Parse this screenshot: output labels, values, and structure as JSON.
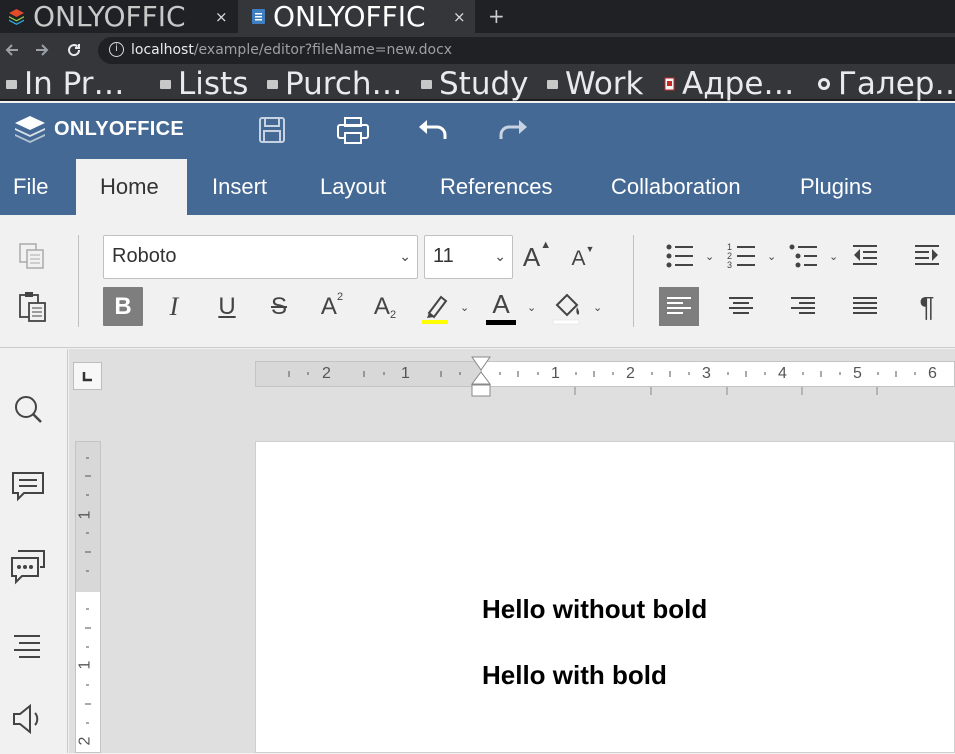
{
  "browser": {
    "tabs": [
      {
        "title": "ONLYOFFIC",
        "close": "×"
      },
      {
        "title": "ONLYOFFIC",
        "close": "×"
      }
    ],
    "new_tab": "+",
    "url_host": "localhost",
    "url_path": "/example/editor?fileName=new.docx",
    "bookmarks": [
      {
        "label": "In Pr…"
      },
      {
        "label": "Lists"
      },
      {
        "label": "Purch…"
      },
      {
        "label": "Study"
      },
      {
        "label": "Work"
      },
      {
        "label": "Адре…"
      },
      {
        "label": "Галер…"
      }
    ]
  },
  "app": {
    "brand": "ONLYOFFICE",
    "menu_tabs": [
      "File",
      "Home",
      "Insert",
      "Layout",
      "References",
      "Collaboration",
      "Plugins"
    ],
    "active_tab": "Home",
    "header_color": "#446995"
  },
  "toolbar": {
    "font_name": "Roboto",
    "font_size": "11",
    "increase_font": "A",
    "decrease_font": "A",
    "bold": "B",
    "italic": "I",
    "underline": "U",
    "strikethrough": "S",
    "superscript": "A",
    "superscript_mark": "2",
    "subscript": "A",
    "subscript_mark": "2",
    "font_color": "A",
    "paragraph_mark": "¶",
    "highlight_color": "#ffff00",
    "text_color": "#000000"
  },
  "ruler": {
    "h_numbers": [
      "2",
      "1",
      "1",
      "2",
      "3",
      "4",
      "5",
      "6"
    ],
    "v_numbers": [
      "1",
      "1",
      "2"
    ]
  },
  "document": {
    "lines": [
      "Hello without bold",
      "Hello with bold"
    ]
  }
}
